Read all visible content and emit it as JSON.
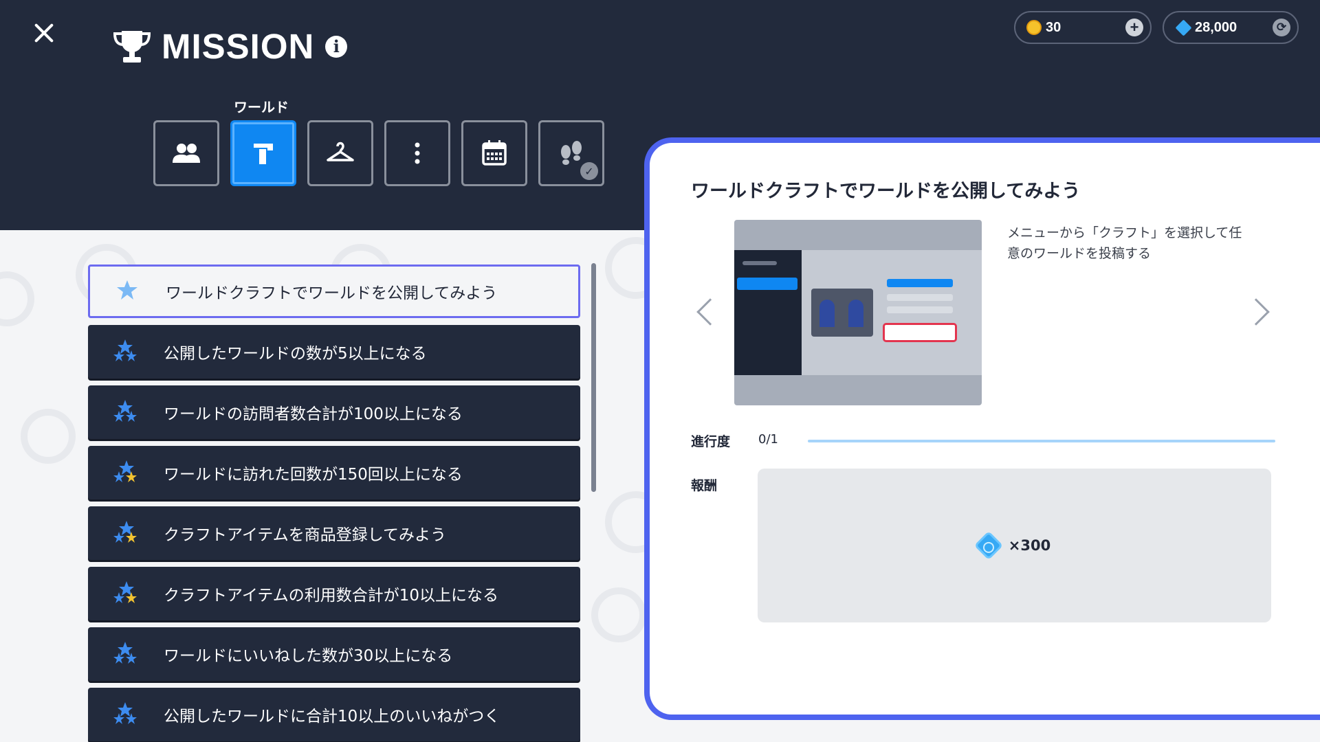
{
  "header": {
    "title": "MISSION",
    "info_icon": "info-icon",
    "close_icon": "close-icon"
  },
  "currency": {
    "coins": "30",
    "gems": "28,000"
  },
  "categories": {
    "active_label": "ワールド",
    "tabs": [
      {
        "icon": "friends-icon",
        "active": false
      },
      {
        "icon": "hammer-icon",
        "active": true
      },
      {
        "icon": "hanger-icon",
        "active": false
      },
      {
        "icon": "more-icon",
        "active": false
      },
      {
        "icon": "calendar-icon",
        "active": false
      },
      {
        "icon": "footprints-icon",
        "active": false,
        "completed": true
      }
    ]
  },
  "missions": [
    {
      "title": "ワールドクラフトでワールドを公開してみよう",
      "stars": 1,
      "selected": true
    },
    {
      "title": "公開したワールドの数が5以上になる",
      "stars": 2
    },
    {
      "title": "ワールドの訪問者数合計が100以上になる",
      "stars": 2
    },
    {
      "title": "ワールドに訪れた回数が150回以上になる",
      "stars": 3
    },
    {
      "title": "クラフトアイテムを商品登録してみよう",
      "stars": 3
    },
    {
      "title": "クラフトアイテムの利用数合計が10以上になる",
      "stars": 3
    },
    {
      "title": "ワールドにいいねした数が30以上になる",
      "stars": 2
    },
    {
      "title": "公開したワールドに合計10以上のいいねがつく",
      "stars": 2
    }
  ],
  "detail": {
    "title": "ワールドクラフトでワールドを公開してみよう",
    "description": "メニューから「クラフト」を選択して任意のワールドを投稿する",
    "progress_label": "進行度",
    "progress_value": "0/1",
    "progress_fraction": 0,
    "reward_label": "報酬",
    "reward_amount": "×300",
    "reward_icon": "gem-icon"
  },
  "colors": {
    "header_bg": "#222a3c",
    "accent_blue": "#0f87f2",
    "panel_border": "#4e63ef",
    "coin": "#f6c22b",
    "gem": "#36a9f5"
  }
}
